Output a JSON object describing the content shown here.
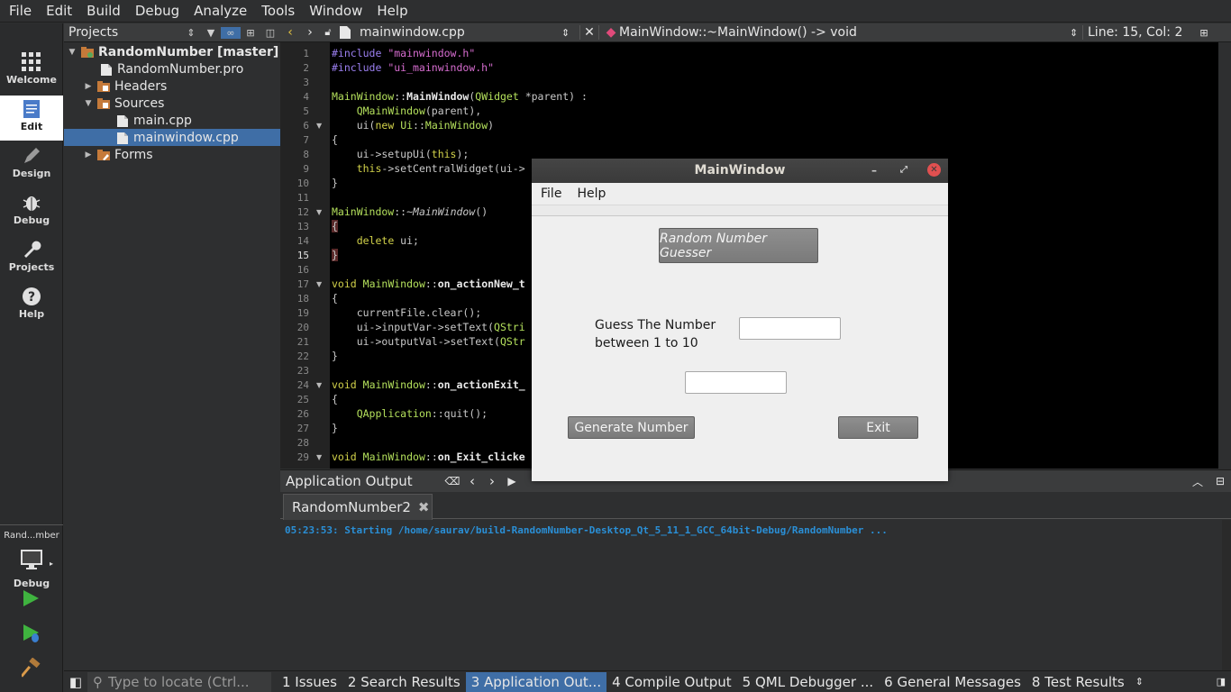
{
  "menubar": [
    "File",
    "Edit",
    "Build",
    "Debug",
    "Analyze",
    "Tools",
    "Window",
    "Help"
  ],
  "modes": [
    {
      "label": "Welcome",
      "icon": "welcome-grid-icon"
    },
    {
      "label": "Edit",
      "icon": "edit-document-icon"
    },
    {
      "label": "Design",
      "icon": "design-pen-icon"
    },
    {
      "label": "Debug",
      "icon": "debug-bug-icon"
    },
    {
      "label": "Projects",
      "icon": "projects-wrench-icon"
    },
    {
      "label": "Help",
      "icon": "help-question-icon"
    }
  ],
  "kit": {
    "name": "Rand...mber",
    "mode": "Debug"
  },
  "projects": {
    "title": "Projects",
    "tree": {
      "project": "RandomNumber [master]",
      "pro_file": "RandomNumber.pro",
      "headers": "Headers",
      "sources": "Sources",
      "main_cpp": "main.cpp",
      "mainwindow_cpp": "mainwindow.cpp",
      "forms": "Forms"
    }
  },
  "editor": {
    "file": "mainwindow.cpp",
    "symbol": "MainWindow::~MainWindow() -> void",
    "position": "Line: 15, Col: 2",
    "line_numbers": [
      "1",
      "2",
      "3",
      "4",
      "5",
      "6",
      "7",
      "8",
      "9",
      "10",
      "11",
      "12",
      "13",
      "14",
      "15",
      "16",
      "17",
      "18",
      "19",
      "20",
      "21",
      "22",
      "23",
      "24",
      "25",
      "26",
      "27",
      "28",
      "29"
    ]
  },
  "output": {
    "title": "Application Output",
    "tab": "RandomNumber2",
    "line": "05:23:53: Starting /home/saurav/build-RandomNumber-Desktop_Qt_5_11_1_GCC_64bit-Debug/RandomNumber ..."
  },
  "statusbar": {
    "locate_placeholder": "Type to locate (Ctrl...",
    "tabs": [
      "1  Issues",
      "2  Search Results",
      "3  Application Out...",
      "4  Compile Output",
      "5  QML Debugger ...",
      "6  General Messages",
      "8  Test Results"
    ]
  },
  "dialog": {
    "title": "MainWindow",
    "menu": [
      "File",
      "Help"
    ],
    "heading": "Random Number Guesser",
    "prompt_line1": "Guess The Number",
    "prompt_line2": "between 1 to 10",
    "generate_label": "Generate Number",
    "exit_label": "Exit"
  },
  "colors": {
    "selection": "#3f6ea6",
    "close_button": "#e05050",
    "output_text": "#2a8fd6"
  }
}
